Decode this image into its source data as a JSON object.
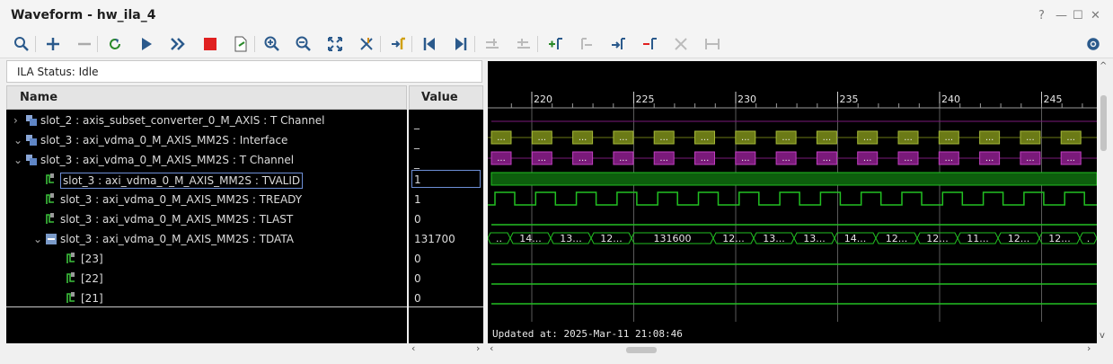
{
  "window": {
    "title": "Waveform - hw_ila_4",
    "controls": [
      "?",
      "—",
      "☐",
      "✕"
    ]
  },
  "toolbar": {
    "icons": [
      "zoom-search-icon",
      "add-icon",
      "remove-icon",
      "refresh-icon",
      "run-icon",
      "fast-forward-icon",
      "stop-icon",
      "export-icon",
      "zoom-in-icon",
      "zoom-out-icon",
      "zoom-fit-icon",
      "cursor-icon",
      "marker-add-icon",
      "go-first-icon",
      "go-last-icon",
      "prev-transition-icon",
      "next-transition-icon",
      "add-marker-icon",
      "prev-marker-icon",
      "next-marker-icon",
      "swap-marker-icon",
      "delete-icon",
      "measure-icon",
      "settings-icon"
    ]
  },
  "ila_status": "ILA Status: Idle",
  "columns": {
    "name": "Name",
    "value": "Value"
  },
  "signals": [
    {
      "name": "slot_2 : axis_subset_converter_0_M_AXIS : T Channel",
      "value": "_",
      "indent": 1,
      "toggle": "›",
      "icon": "bus"
    },
    {
      "name": "slot_3 : axi_vdma_0_M_AXIS_MM2S : Interface",
      "value": "_",
      "indent": 0,
      "toggle": "⌄",
      "icon": "bus"
    },
    {
      "name": "slot_3 : axi_vdma_0_M_AXIS_MM2S : T Channel",
      "value": "_",
      "indent": 1,
      "toggle": "⌄",
      "icon": "bus"
    },
    {
      "name": "slot_3 : axi_vdma_0_M_AXIS_MM2S : TVALID",
      "value": "1",
      "indent": 2,
      "toggle": "",
      "icon": "bit",
      "selected": true
    },
    {
      "name": "slot_3 : axi_vdma_0_M_AXIS_MM2S : TREADY",
      "value": "1",
      "indent": 2,
      "toggle": "",
      "icon": "bit"
    },
    {
      "name": "slot_3 : axi_vdma_0_M_AXIS_MM2S : TLAST",
      "value": "0",
      "indent": 2,
      "toggle": "",
      "icon": "bit"
    },
    {
      "name": "slot_3 : axi_vdma_0_M_AXIS_MM2S : TDATA",
      "value": "131700",
      "indent": 2,
      "toggle": "⌄",
      "icon": "vector"
    },
    {
      "name": "[23]",
      "value": "0",
      "indent": 3,
      "toggle": "",
      "icon": "bit"
    },
    {
      "name": "[22]",
      "value": "0",
      "indent": 3,
      "toggle": "",
      "icon": "bit"
    },
    {
      "name": "[21]",
      "value": "0",
      "indent": 3,
      "toggle": "",
      "icon": "bit"
    }
  ],
  "timeline": {
    "ticks": [
      "220",
      "225",
      "230",
      "235",
      "240",
      "245"
    ]
  },
  "tdata_labels": [
    "..",
    "14...",
    "13...",
    "12...",
    "131600",
    "12...",
    "13...",
    "13...",
    "14...",
    "12...",
    "12...",
    "11...",
    "12...",
    "12...",
    "."
  ],
  "bus_label": "...",
  "updated": "Updated at: 2025-Mar-11 21:08:46",
  "colors": {
    "wave": "#22c022",
    "bus_olive": "#6b7a16",
    "bus_purple": "#7a1a7a",
    "tvalid_fill": "#0d5e0d",
    "grid": "#5a5a5a",
    "accent_red": "#e02020"
  }
}
